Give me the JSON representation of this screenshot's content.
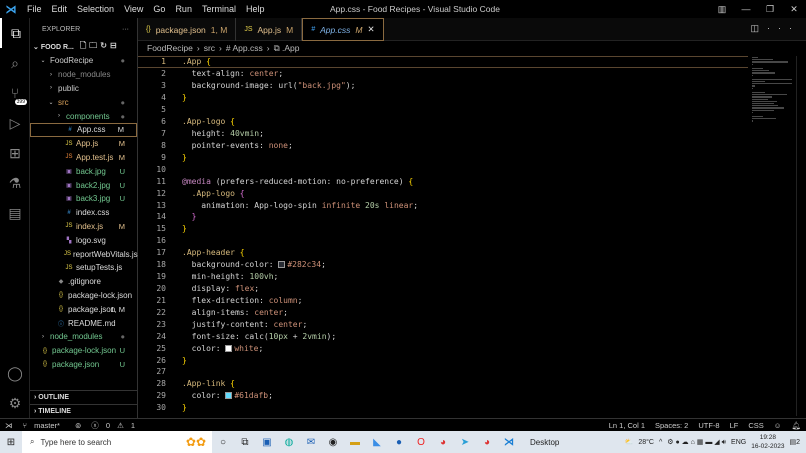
{
  "titlebar": {
    "menu": [
      "File",
      "Edit",
      "Selection",
      "View",
      "Go",
      "Run",
      "Terminal",
      "Help"
    ],
    "title": "App.css - Food Recipes - Visual Studio Code"
  },
  "activity": {
    "scm_badge": "399"
  },
  "sidebar": {
    "header": "EXPLORER",
    "more": "···",
    "root": "FOOD R...",
    "items": [
      {
        "label": "FoodRecipe",
        "indent": 1,
        "kind": "folder-open",
        "color": "#ccc",
        "status": "●"
      },
      {
        "label": "node_modules",
        "indent": 2,
        "kind": "folder",
        "color": "#888",
        "status": ""
      },
      {
        "label": "public",
        "indent": 2,
        "kind": "folder",
        "color": "#ccc",
        "status": ""
      },
      {
        "label": "src",
        "indent": 2,
        "kind": "folder-open",
        "color": "#d7a05a",
        "status": "●"
      },
      {
        "label": "components",
        "indent": 3,
        "kind": "folder",
        "color": "#73c991",
        "status": "●"
      },
      {
        "label": "App.css",
        "indent": 4,
        "kind": "css",
        "color": "#ddd",
        "status": "M",
        "selected": true
      },
      {
        "label": "App.js",
        "indent": 4,
        "kind": "js",
        "color": "#e2c08d",
        "status": "M"
      },
      {
        "label": "App.test.js",
        "indent": 4,
        "kind": "test",
        "color": "#e2c08d",
        "status": "M"
      },
      {
        "label": "back.jpg",
        "indent": 4,
        "kind": "img",
        "color": "#73c991",
        "status": "U"
      },
      {
        "label": "back2.jpg",
        "indent": 4,
        "kind": "img",
        "color": "#73c991",
        "status": "U"
      },
      {
        "label": "back3.jpg",
        "indent": 4,
        "kind": "img",
        "color": "#73c991",
        "status": "U"
      },
      {
        "label": "index.css",
        "indent": 4,
        "kind": "css",
        "color": "#ddd",
        "status": ""
      },
      {
        "label": "index.js",
        "indent": 4,
        "kind": "js",
        "color": "#e2c08d",
        "status": "M"
      },
      {
        "label": "logo.svg",
        "indent": 4,
        "kind": "svg",
        "color": "#ddd",
        "status": ""
      },
      {
        "label": "reportWebVitals.js",
        "indent": 4,
        "kind": "js",
        "color": "#ddd",
        "status": ""
      },
      {
        "label": "setupTests.js",
        "indent": 4,
        "kind": "js",
        "color": "#ddd",
        "status": ""
      },
      {
        "label": ".gitignore",
        "indent": 3,
        "kind": "git",
        "color": "#ddd",
        "status": ""
      },
      {
        "label": "package-lock.json",
        "indent": 3,
        "kind": "json",
        "color": "#ddd",
        "status": ""
      },
      {
        "label": "package.json",
        "indent": 3,
        "kind": "json",
        "color": "#ddd",
        "status": "1, M"
      },
      {
        "label": "README.md",
        "indent": 3,
        "kind": "info",
        "color": "#ddd",
        "status": ""
      },
      {
        "label": "node_modules",
        "indent": 1,
        "kind": "folder",
        "color": "#73c991",
        "status": "●"
      },
      {
        "label": "package-lock.json",
        "indent": 1,
        "kind": "json",
        "color": "#73c991",
        "status": "U"
      },
      {
        "label": "package.json",
        "indent": 1,
        "kind": "json",
        "color": "#73c991",
        "status": "U"
      }
    ],
    "outline": "OUTLINE",
    "timeline": "TIMELINE"
  },
  "tabs": [
    {
      "icon": "{}",
      "label": "package.json",
      "status": "1, M"
    },
    {
      "icon": "JS",
      "label": "App.js",
      "status": "M"
    },
    {
      "icon": "#",
      "label": "App.css",
      "status": "M",
      "active": true
    }
  ],
  "breadcrumb": [
    "FoodRecipe",
    "src",
    "# App.css",
    "⧉ .App"
  ],
  "code": [
    [
      [
        "sel",
        ".App "
      ],
      [
        "brace",
        "{"
      ]
    ],
    [
      [
        "prop",
        "  text-align"
      ],
      [
        "p",
        ": "
      ],
      [
        "val",
        "center"
      ],
      [
        "p",
        ";"
      ]
    ],
    [
      [
        "prop",
        "  background-image"
      ],
      [
        "p",
        ": url("
      ],
      [
        "val",
        "\"back.jpg\""
      ],
      [
        "p",
        ");"
      ]
    ],
    [
      [
        "brace",
        "}"
      ]
    ],
    [],
    [
      [
        "sel",
        ".App-logo "
      ],
      [
        "brace",
        "{"
      ]
    ],
    [
      [
        "prop",
        "  height"
      ],
      [
        "p",
        ": "
      ],
      [
        "num",
        "40vmin"
      ],
      [
        "p",
        ";"
      ]
    ],
    [
      [
        "prop",
        "  pointer-events"
      ],
      [
        "p",
        ": "
      ],
      [
        "val",
        "none"
      ],
      [
        "p",
        ";"
      ]
    ],
    [
      [
        "brace",
        "}"
      ]
    ],
    [],
    [
      [
        "at",
        "@media"
      ],
      [
        "p",
        " (prefers-reduced-motion: no-preference) "
      ],
      [
        "brace",
        "{"
      ]
    ],
    [
      [
        "sel",
        "  .App-logo "
      ],
      [
        "br2",
        "{"
      ]
    ],
    [
      [
        "prop",
        "    animation"
      ],
      [
        "p",
        ": App-logo-spin "
      ],
      [
        "val",
        "infinite "
      ],
      [
        "num",
        "20s "
      ],
      [
        "val",
        "linear"
      ],
      [
        "p",
        ";"
      ]
    ],
    [
      [
        "br2",
        "  }"
      ]
    ],
    [
      [
        "brace",
        "}"
      ]
    ],
    [],
    [
      [
        "sel",
        ".App-header "
      ],
      [
        "brace",
        "{"
      ]
    ],
    [
      [
        "prop",
        "  background-color"
      ],
      [
        "p",
        ": "
      ],
      [
        "swatch",
        "#282c34"
      ],
      [
        "val",
        "#282c34"
      ],
      [
        "p",
        ";"
      ]
    ],
    [
      [
        "prop",
        "  min-height"
      ],
      [
        "p",
        ": "
      ],
      [
        "num",
        "100vh"
      ],
      [
        "p",
        ";"
      ]
    ],
    [
      [
        "prop",
        "  display"
      ],
      [
        "p",
        ": "
      ],
      [
        "val",
        "flex"
      ],
      [
        "p",
        ";"
      ]
    ],
    [
      [
        "prop",
        "  flex-direction"
      ],
      [
        "p",
        ": "
      ],
      [
        "val",
        "column"
      ],
      [
        "p",
        ";"
      ]
    ],
    [
      [
        "prop",
        "  align-items"
      ],
      [
        "p",
        ": "
      ],
      [
        "val",
        "center"
      ],
      [
        "p",
        ";"
      ]
    ],
    [
      [
        "prop",
        "  justify-content"
      ],
      [
        "p",
        ": "
      ],
      [
        "val",
        "center"
      ],
      [
        "p",
        ";"
      ]
    ],
    [
      [
        "prop",
        "  font-size"
      ],
      [
        "p",
        ": calc("
      ],
      [
        "num",
        "10px"
      ],
      [
        "p",
        " + "
      ],
      [
        "num",
        "2vmin"
      ],
      [
        "p",
        ");"
      ]
    ],
    [
      [
        "prop",
        "  color"
      ],
      [
        "p",
        ": "
      ],
      [
        "swatch",
        "#ffffff"
      ],
      [
        "val",
        "white"
      ],
      [
        "p",
        ";"
      ]
    ],
    [
      [
        "brace",
        "}"
      ]
    ],
    [],
    [
      [
        "sel",
        ".App-link "
      ],
      [
        "brace",
        "{"
      ]
    ],
    [
      [
        "prop",
        "  color"
      ],
      [
        "p",
        ": "
      ],
      [
        "swatch",
        "#61dafb"
      ],
      [
        "val",
        "#61dafb"
      ],
      [
        "p",
        ";"
      ]
    ],
    [
      [
        "brace",
        "}"
      ]
    ]
  ],
  "status": {
    "branch": "master*",
    "errors": "0",
    "warnings": "1",
    "position": "Ln 1, Col 1",
    "spaces": "Spaces: 2",
    "encoding": "UTF-8",
    "eol": "LF",
    "language": "CSS"
  },
  "taskbar": {
    "search_placeholder": "Type here to search",
    "desktop": "Desktop",
    "weather": "28°C",
    "lang": "ENG",
    "time": "19:28",
    "date": "16-02-2023",
    "notif": "2"
  }
}
